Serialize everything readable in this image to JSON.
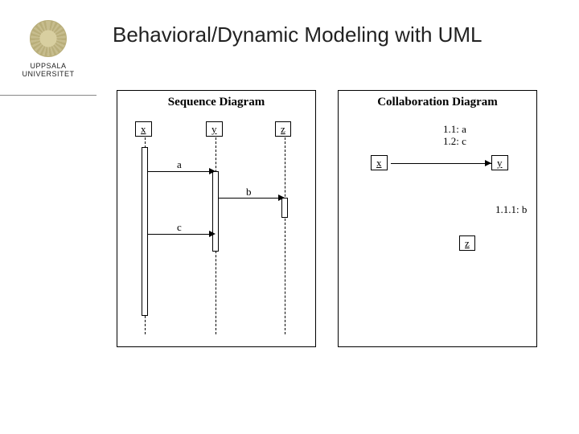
{
  "university": {
    "line1": "UPPSALA",
    "line2": "UNIVERSITET"
  },
  "title": "Behavioral/Dynamic Modeling with UML",
  "sequence": {
    "title": "Sequence Diagram",
    "objects": {
      "x": "x",
      "y": "y",
      "z": "z"
    },
    "messages": {
      "a": "a",
      "b": "b",
      "c": "c"
    }
  },
  "collaboration": {
    "title": "Collaboration Diagram",
    "objects": {
      "x": "x",
      "y": "y",
      "z": "z"
    },
    "labels": {
      "a": "1.1: a",
      "c": "1.2: c",
      "b": "1.1.1: b"
    }
  },
  "chart_data": {
    "type": "table",
    "description": "UML sequence and equivalent collaboration diagram",
    "objects": [
      "x",
      "y",
      "z"
    ],
    "sequence_messages": [
      {
        "seq": "1.1",
        "from": "x",
        "to": "y",
        "name": "a"
      },
      {
        "seq": "1.1.1",
        "from": "y",
        "to": "z",
        "name": "b"
      },
      {
        "seq": "1.2",
        "from": "x",
        "to": "y",
        "name": "c"
      }
    ],
    "collaboration_links": [
      {
        "between": [
          "x",
          "y"
        ],
        "messages": [
          "1.1: a",
          "1.2: c"
        ]
      },
      {
        "between": [
          "y",
          "z"
        ],
        "messages": [
          "1.1.1: b"
        ]
      }
    ]
  }
}
